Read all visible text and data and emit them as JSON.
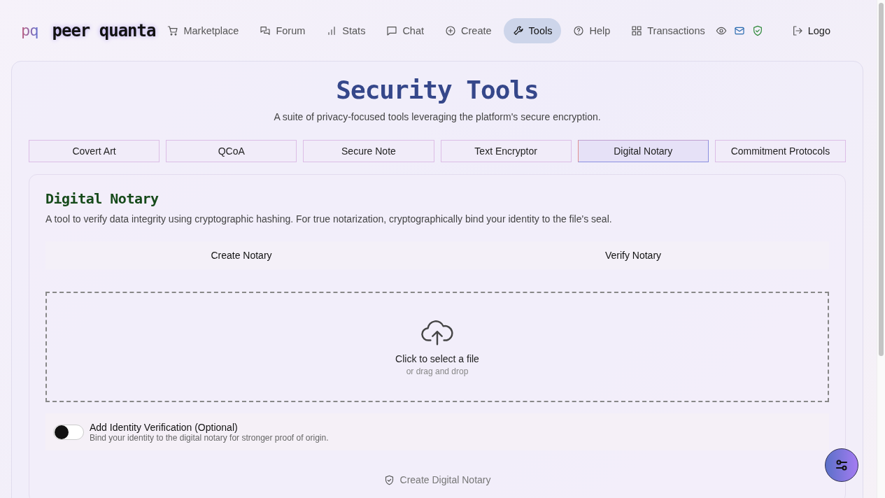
{
  "brand": {
    "mark": "pq",
    "name": "peer quanta"
  },
  "nav": [
    {
      "label": "Marketplace",
      "selected": false
    },
    {
      "label": "Forum",
      "selected": false
    },
    {
      "label": "Stats",
      "selected": false
    },
    {
      "label": "Chat",
      "selected": false
    },
    {
      "label": "Create",
      "selected": false
    },
    {
      "label": "Tools",
      "selected": true
    },
    {
      "label": "Help",
      "selected": false
    },
    {
      "label": "Transactions",
      "selected": false
    }
  ],
  "logout": {
    "label": "Logo"
  },
  "page": {
    "title": "Security Tools",
    "subtitle": "A suite of privacy-focused tools leveraging the platform's secure encryption."
  },
  "tool_tabs": [
    {
      "label": "Covert Art",
      "selected": false
    },
    {
      "label": "QCoA",
      "selected": false
    },
    {
      "label": "Secure Note",
      "selected": false
    },
    {
      "label": "Text Encryptor",
      "selected": false
    },
    {
      "label": "Digital Notary",
      "selected": true
    },
    {
      "label": "Commitment Protocols",
      "selected": false
    }
  ],
  "panel": {
    "title": "Digital Notary",
    "description": "A tool to verify data integrity using cryptographic hashing. For true notarization, cryptographically bind your identity to the file's seal.",
    "mode_tabs": [
      {
        "label": "Create Notary"
      },
      {
        "label": "Verify Notary"
      }
    ],
    "dropzone": {
      "label": "Click to select a file",
      "hint": "or drag and drop"
    },
    "identity": {
      "label": "Add Identity Verification (Optional)",
      "description": "Bind your identity to the digital notary for stronger proof of origin.",
      "on": false
    },
    "submit": {
      "label": "Create Digital Notary",
      "disabled": true
    }
  }
}
